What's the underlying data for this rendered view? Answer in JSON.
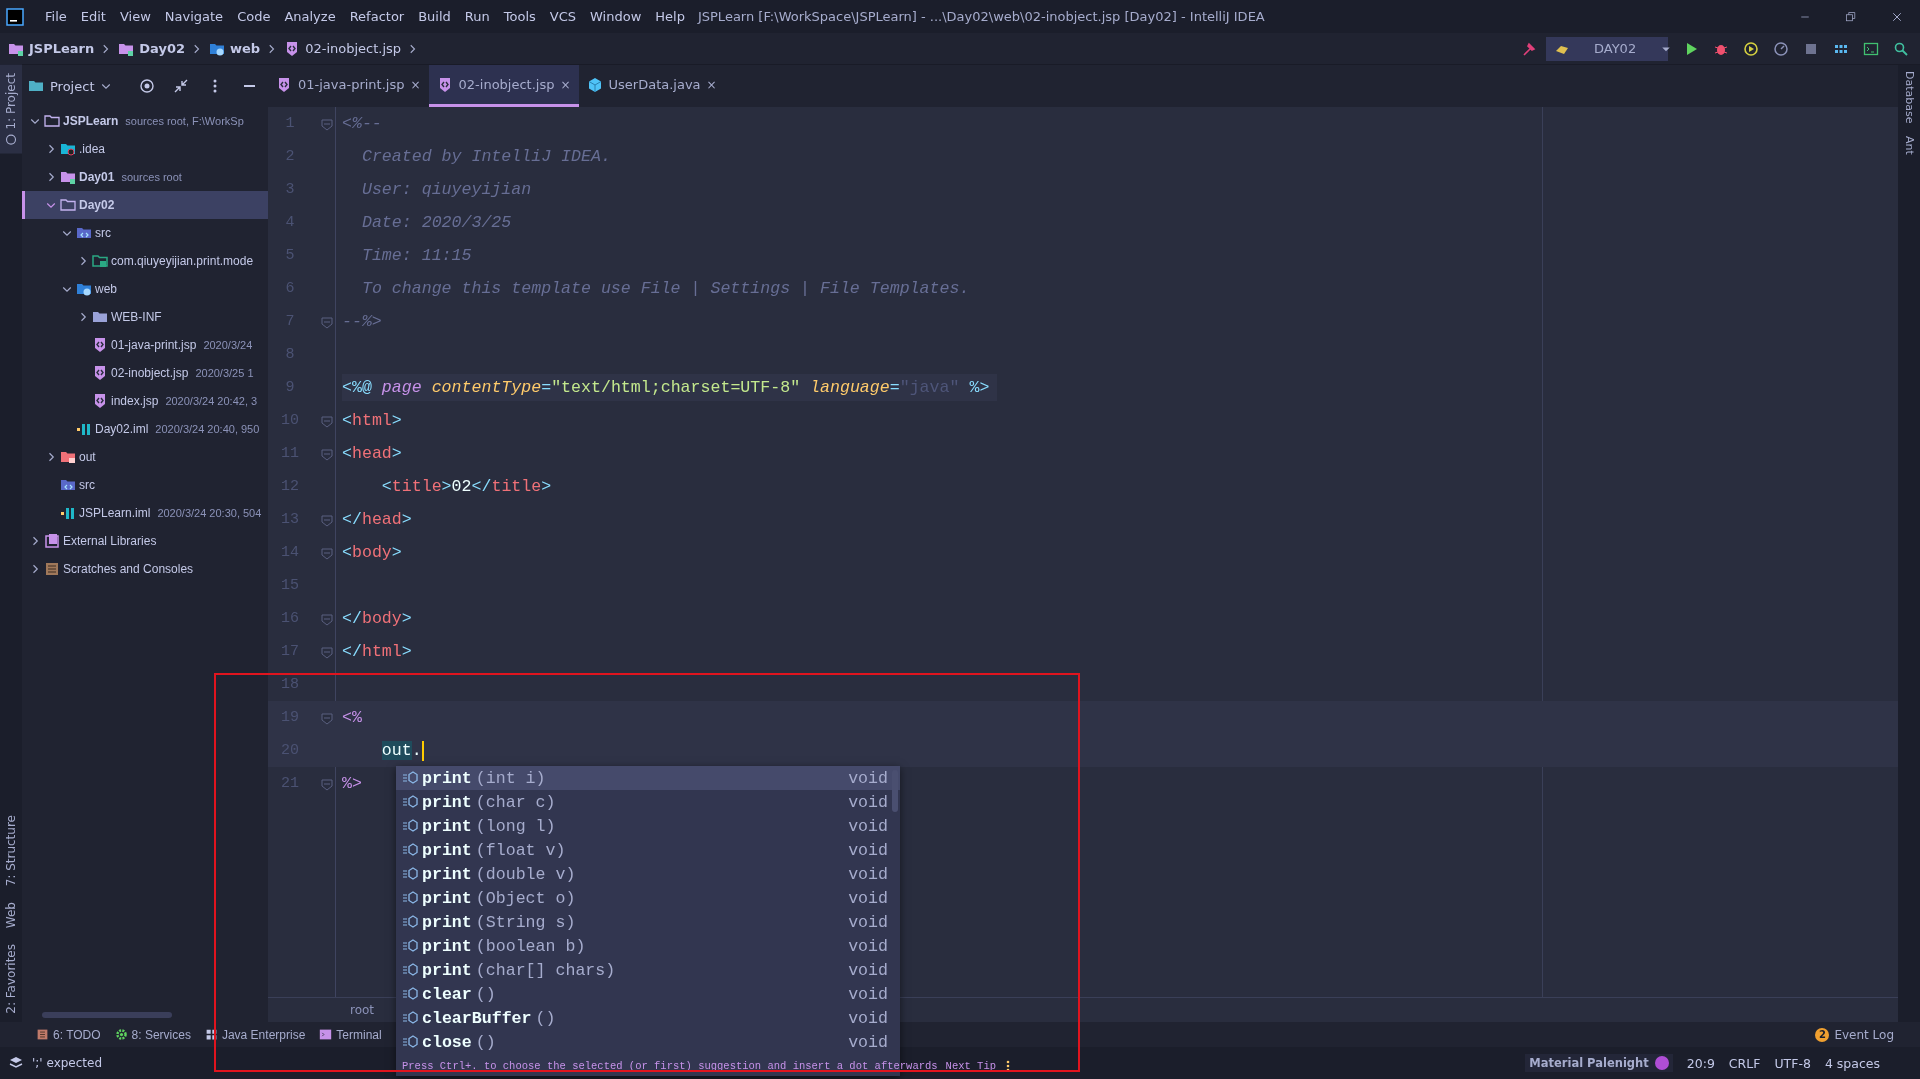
{
  "window": {
    "title": "JSPLearn [F:\\WorkSpace\\JSPLearn] - ...\\Day02\\web\\02-inobject.jsp [Day02] - IntelliJ IDEA"
  },
  "menu": [
    "File",
    "Edit",
    "View",
    "Navigate",
    "Code",
    "Analyze",
    "Refactor",
    "Build",
    "Run",
    "Tools",
    "VCS",
    "Window",
    "Help"
  ],
  "breadcrumbs": [
    {
      "label": "JSPLearn",
      "kind": "module"
    },
    {
      "label": "Day02",
      "kind": "module"
    },
    {
      "label": "web",
      "kind": "web"
    },
    {
      "label": "02-inobject.jsp",
      "kind": "jsp"
    }
  ],
  "run_config": {
    "label": "DAY02"
  },
  "left_strip": [
    {
      "label": "1: Project",
      "kind": "top",
      "selected": true
    },
    {
      "label": "7: Structure",
      "kind": "bottom",
      "selected": false
    },
    {
      "label": "Web",
      "kind": "bottom",
      "selected": false
    },
    {
      "label": "2: Favorites",
      "kind": "bottom",
      "selected": false
    }
  ],
  "right_strip": [
    {
      "label": "Database"
    },
    {
      "label": "Ant"
    }
  ],
  "project_panel": {
    "title": "Project",
    "tree": [
      {
        "label": "JSPLearn",
        "note": "sources root, F:\\WorkSp",
        "bold": true,
        "kind": "folder",
        "expanded": true,
        "selected": false,
        "children": [
          {
            "label": ".idea",
            "kind": "idea",
            "expanded": false,
            "selected": false
          },
          {
            "label": "Day01",
            "note": "sources root",
            "bold": true,
            "kind": "module",
            "expanded": false,
            "selected": false
          },
          {
            "label": "Day02",
            "bold": true,
            "kind": "folder",
            "expanded": true,
            "selected": true,
            "children": [
              {
                "label": "src",
                "kind": "src",
                "expanded": true,
                "selected": false,
                "children": [
                  {
                    "label": "com.qiuyeyijian.print.mode",
                    "kind": "package",
                    "expanded": false,
                    "selected": false
                  }
                ]
              },
              {
                "label": "web",
                "kind": "web",
                "expanded": true,
                "selected": false,
                "children": [
                  {
                    "label": "WEB-INF",
                    "kind": "plain",
                    "expanded": false,
                    "selected": false
                  },
                  {
                    "label": "01-java-print.jsp",
                    "note": "2020/3/24",
                    "kind": "jsp",
                    "selected": false
                  },
                  {
                    "label": "02-inobject.jsp",
                    "note": "2020/3/25 1",
                    "kind": "jsp",
                    "selected": false
                  },
                  {
                    "label": "index.jsp",
                    "note": "2020/3/24 20:42, 3",
                    "kind": "jsp",
                    "selected": false
                  }
                ]
              },
              {
                "label": "Day02.iml",
                "note": "2020/3/24 20:40, 950",
                "kind": "iml",
                "selected": false
              }
            ]
          },
          {
            "label": "out",
            "kind": "out",
            "expanded": false,
            "selected": false
          },
          {
            "label": "src",
            "kind": "src",
            "selected": false
          },
          {
            "label": "JSPLearn.iml",
            "note": "2020/3/24 20:30, 504",
            "kind": "iml",
            "selected": false
          }
        ]
      },
      {
        "label": "External Libraries",
        "kind": "libs",
        "expanded": false,
        "selected": false
      },
      {
        "label": "Scratches and Consoles",
        "kind": "scratches",
        "expanded": false,
        "selected": false
      }
    ]
  },
  "tabs": [
    {
      "label": "01-java-print.jsp",
      "kind": "jsp",
      "selected": false,
      "close": "×"
    },
    {
      "label": "02-inobject.jsp",
      "kind": "jsp",
      "selected": true,
      "close": "×"
    },
    {
      "label": "UserData.java",
      "kind": "java",
      "selected": false,
      "close": "×"
    }
  ],
  "editor": {
    "lines": [
      {
        "number": "1",
        "fold": true,
        "highlighted": false,
        "caret": false,
        "tokens": [
          {
            "kind": "comment",
            "text": "<%--"
          }
        ]
      },
      {
        "number": "2",
        "fold": false,
        "highlighted": false,
        "caret": false,
        "tokens": [
          {
            "kind": "comment",
            "text": "  Created by IntelliJ IDEA."
          }
        ]
      },
      {
        "number": "3",
        "fold": false,
        "highlighted": false,
        "caret": false,
        "tokens": [
          {
            "kind": "comment",
            "text": "  User: qiuyeyijian"
          }
        ]
      },
      {
        "number": "4",
        "fold": false,
        "highlighted": false,
        "caret": false,
        "tokens": [
          {
            "kind": "comment",
            "text": "  Date: 2020/3/25"
          }
        ]
      },
      {
        "number": "5",
        "fold": false,
        "highlighted": false,
        "caret": false,
        "tokens": [
          {
            "kind": "comment",
            "text": "  Time: 11:15"
          }
        ]
      },
      {
        "number": "6",
        "fold": false,
        "highlighted": false,
        "caret": false,
        "tokens": [
          {
            "kind": "comment",
            "text": "  To change this template use File | Settings | File Templates."
          }
        ]
      },
      {
        "number": "7",
        "fold": true,
        "highlighted": false,
        "caret": false,
        "tokens": [
          {
            "kind": "comment",
            "text": "--%>"
          }
        ]
      },
      {
        "number": "8",
        "fold": false,
        "highlighted": false,
        "caret": false
      },
      {
        "number": "9",
        "fold": false,
        "highlighted": true,
        "caret": false,
        "tokens": [
          {
            "kind": "bracket",
            "text": "<%@ "
          },
          {
            "kind": "directive",
            "text": "page "
          },
          {
            "kind": "attr",
            "text": "contentType"
          },
          {
            "kind": "bracket",
            "text": "="
          },
          {
            "kind": "string",
            "text": "\"text/html;charset=UTF-8\" "
          },
          {
            "kind": "attr",
            "text": "language"
          },
          {
            "kind": "bracket",
            "text": "="
          },
          {
            "kind": "muted",
            "text": "\"java\" "
          },
          {
            "kind": "bracket",
            "text": "%>"
          }
        ]
      },
      {
        "number": "10",
        "fold": true,
        "highlighted": false,
        "caret": false,
        "tokens": [
          {
            "kind": "bracket",
            "text": "<"
          },
          {
            "kind": "tag",
            "text": "html"
          },
          {
            "kind": "bracket",
            "text": ">"
          }
        ]
      },
      {
        "number": "11",
        "fold": true,
        "highlighted": false,
        "caret": false,
        "tokens": [
          {
            "kind": "bracket",
            "text": "<"
          },
          {
            "kind": "tag",
            "text": "head"
          },
          {
            "kind": "bracket",
            "text": ">"
          }
        ]
      },
      {
        "number": "12",
        "fold": false,
        "highlighted": false,
        "caret": false,
        "tokens": [
          {
            "kind": "bracket",
            "text": "    <"
          },
          {
            "kind": "tag",
            "text": "title"
          },
          {
            "kind": "bracket",
            "text": ">"
          },
          {
            "kind": "plain",
            "text": "02"
          },
          {
            "kind": "bracket",
            "text": "</"
          },
          {
            "kind": "tag",
            "text": "title"
          },
          {
            "kind": "bracket",
            "text": ">"
          }
        ]
      },
      {
        "number": "13",
        "fold": true,
        "highlighted": false,
        "caret": false,
        "tokens": [
          {
            "kind": "bracket",
            "text": "</"
          },
          {
            "kind": "tag",
            "text": "head"
          },
          {
            "kind": "bracket",
            "text": ">"
          }
        ]
      },
      {
        "number": "14",
        "fold": true,
        "highlighted": false,
        "caret": false,
        "tokens": [
          {
            "kind": "bracket",
            "text": "<"
          },
          {
            "kind": "tag",
            "text": "body"
          },
          {
            "kind": "bracket",
            "text": ">"
          }
        ]
      },
      {
        "number": "15",
        "fold": false,
        "highlighted": false,
        "caret": false
      },
      {
        "number": "16",
        "fold": true,
        "highlighted": false,
        "caret": false,
        "tokens": [
          {
            "kind": "bracket",
            "text": "</"
          },
          {
            "kind": "tag",
            "text": "body"
          },
          {
            "kind": "bracket",
            "text": ">"
          }
        ]
      },
      {
        "number": "17",
        "fold": true,
        "highlighted": false,
        "caret": false,
        "tokens": [
          {
            "kind": "bracket",
            "text": "</"
          },
          {
            "kind": "tag",
            "text": "html"
          },
          {
            "kind": "bracket",
            "text": ">"
          }
        ]
      },
      {
        "number": "18",
        "fold": false,
        "highlighted": false,
        "caret": false
      },
      {
        "number": "19",
        "fold": true,
        "highlighted": true,
        "caret": false,
        "tokens": [
          {
            "kind": "scriptlet",
            "text": "<%"
          }
        ]
      },
      {
        "number": "20",
        "fold": false,
        "highlighted": true,
        "caret": true,
        "tokens": [
          {
            "kind": "match",
            "text": "    out"
          },
          {
            "kind": "plain",
            "text": "."
          }
        ]
      },
      {
        "number": "21",
        "fold": true,
        "highlighted": false,
        "caret": false,
        "tokens": [
          {
            "kind": "scriptlet",
            "text": "%>"
          }
        ]
      }
    ],
    "breadcrumb": "root"
  },
  "completion": {
    "items": [
      {
        "name": "print",
        "params": "(int i)",
        "type": "void",
        "selected": true
      },
      {
        "name": "print",
        "params": "(char c)",
        "type": "void",
        "selected": false
      },
      {
        "name": "print",
        "params": "(long l)",
        "type": "void",
        "selected": false
      },
      {
        "name": "print",
        "params": "(float v)",
        "type": "void",
        "selected": false
      },
      {
        "name": "print",
        "params": "(double v)",
        "type": "void",
        "selected": false
      },
      {
        "name": "print",
        "params": "(Object o)",
        "type": "void",
        "selected": false
      },
      {
        "name": "print",
        "params": "(String s)",
        "type": "void",
        "selected": false
      },
      {
        "name": "print",
        "params": "(boolean b)",
        "type": "void",
        "selected": false
      },
      {
        "name": "print",
        "params": "(char[] chars)",
        "type": "void",
        "selected": false
      },
      {
        "name": "clear",
        "params": "()",
        "type": "void",
        "selected": false
      },
      {
        "name": "clearBuffer",
        "params": "()",
        "type": "void",
        "selected": false
      },
      {
        "name": "close",
        "params": "()",
        "type": "void",
        "selected": false
      }
    ],
    "hint": "Press Ctrl+. to choose the selected (or first) suggestion and insert a dot afterwards",
    "tip_link": "Next Tip"
  },
  "tool_windows": [
    {
      "label": "6: TODO",
      "kind": "todo"
    },
    {
      "label": "8: Services",
      "kind": "services"
    },
    {
      "label": "Java Enterprise",
      "kind": "enterprise"
    },
    {
      "label": "Terminal",
      "kind": "terminal"
    }
  ],
  "event_log": {
    "label": "Event Log",
    "count": "2"
  },
  "status_bar": {
    "message": "';' expected",
    "theme": "Material Palenight",
    "position": "20:9",
    "line_ending": "CRLF",
    "encoding": "UTF-8",
    "indent": "4 spaces"
  },
  "annotation": {
    "kind": "rectangle"
  }
}
